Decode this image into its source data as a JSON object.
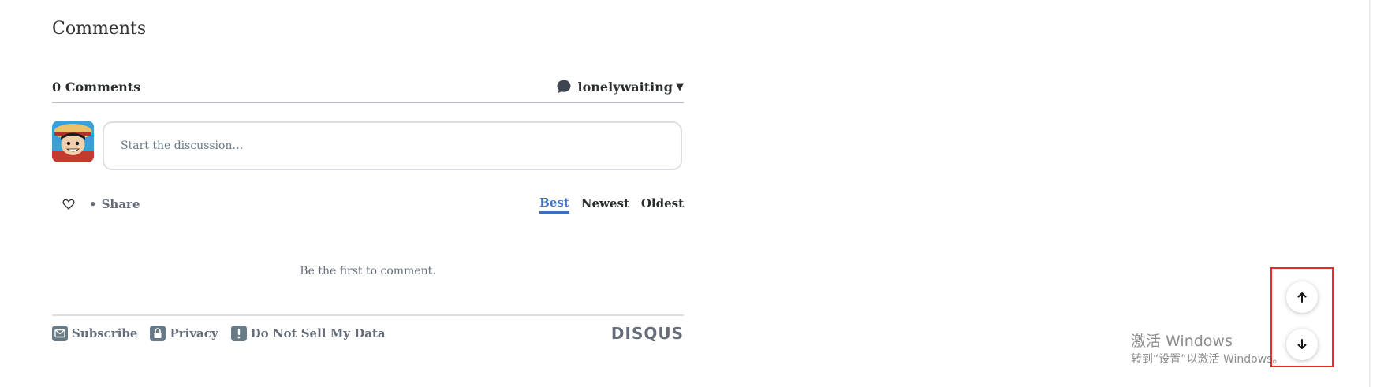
{
  "section": {
    "title": "Comments"
  },
  "disqus": {
    "comment_count": "0 Comments",
    "username": "lonelywaiting",
    "composer_placeholder": "Start the discussion…",
    "share_label": "Share",
    "share_bullet": "•",
    "sort_tabs": [
      {
        "label": "Best",
        "active": true
      },
      {
        "label": "Newest",
        "active": false
      },
      {
        "label": "Oldest",
        "active": false
      }
    ],
    "empty_note": "Be the first to comment.",
    "footer": {
      "subscribe": "Subscribe",
      "privacy": "Privacy",
      "do_not_sell": "Do Not Sell My Data",
      "logo": "DISQUS"
    }
  },
  "watermark": {
    "line1": "激活 Windows",
    "line2": "转到“设置”以激活 Windows。"
  },
  "icons": {
    "user_menu": "chat-bubble-icon",
    "recommend": "heart-icon",
    "subscribe": "envelope-icon",
    "privacy": "lock-icon",
    "do_not_sell": "exclamation-icon",
    "scroll_up": "arrow-up-icon",
    "scroll_down": "arrow-down-icon"
  },
  "colors": {
    "active_tab": "#3f6fc4",
    "text_muted": "#656c7a",
    "highlight_frame": "#e52b2b"
  }
}
